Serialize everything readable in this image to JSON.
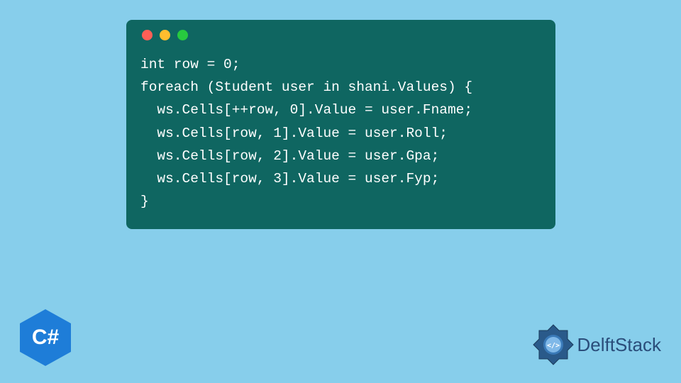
{
  "code": {
    "line1": "int row = 0;",
    "line2": "foreach (Student user in shani.Values) {",
    "line3": "  ws.Cells[++row, 0].Value = user.Fname;",
    "line4": "  ws.Cells[row, 1].Value = user.Roll;",
    "line5": "  ws.Cells[row, 2].Value = user.Gpa;",
    "line6": "  ws.Cells[row, 3].Value = user.Fyp;",
    "line7": "}"
  },
  "csharp": {
    "label": "C#"
  },
  "delftstack": {
    "label": "DelftStack"
  },
  "colors": {
    "background": "#87ceeb",
    "codeWindow": "#0f6661",
    "csharpHex": "#1e7dd8",
    "delftstackText": "#2a4d7a"
  }
}
